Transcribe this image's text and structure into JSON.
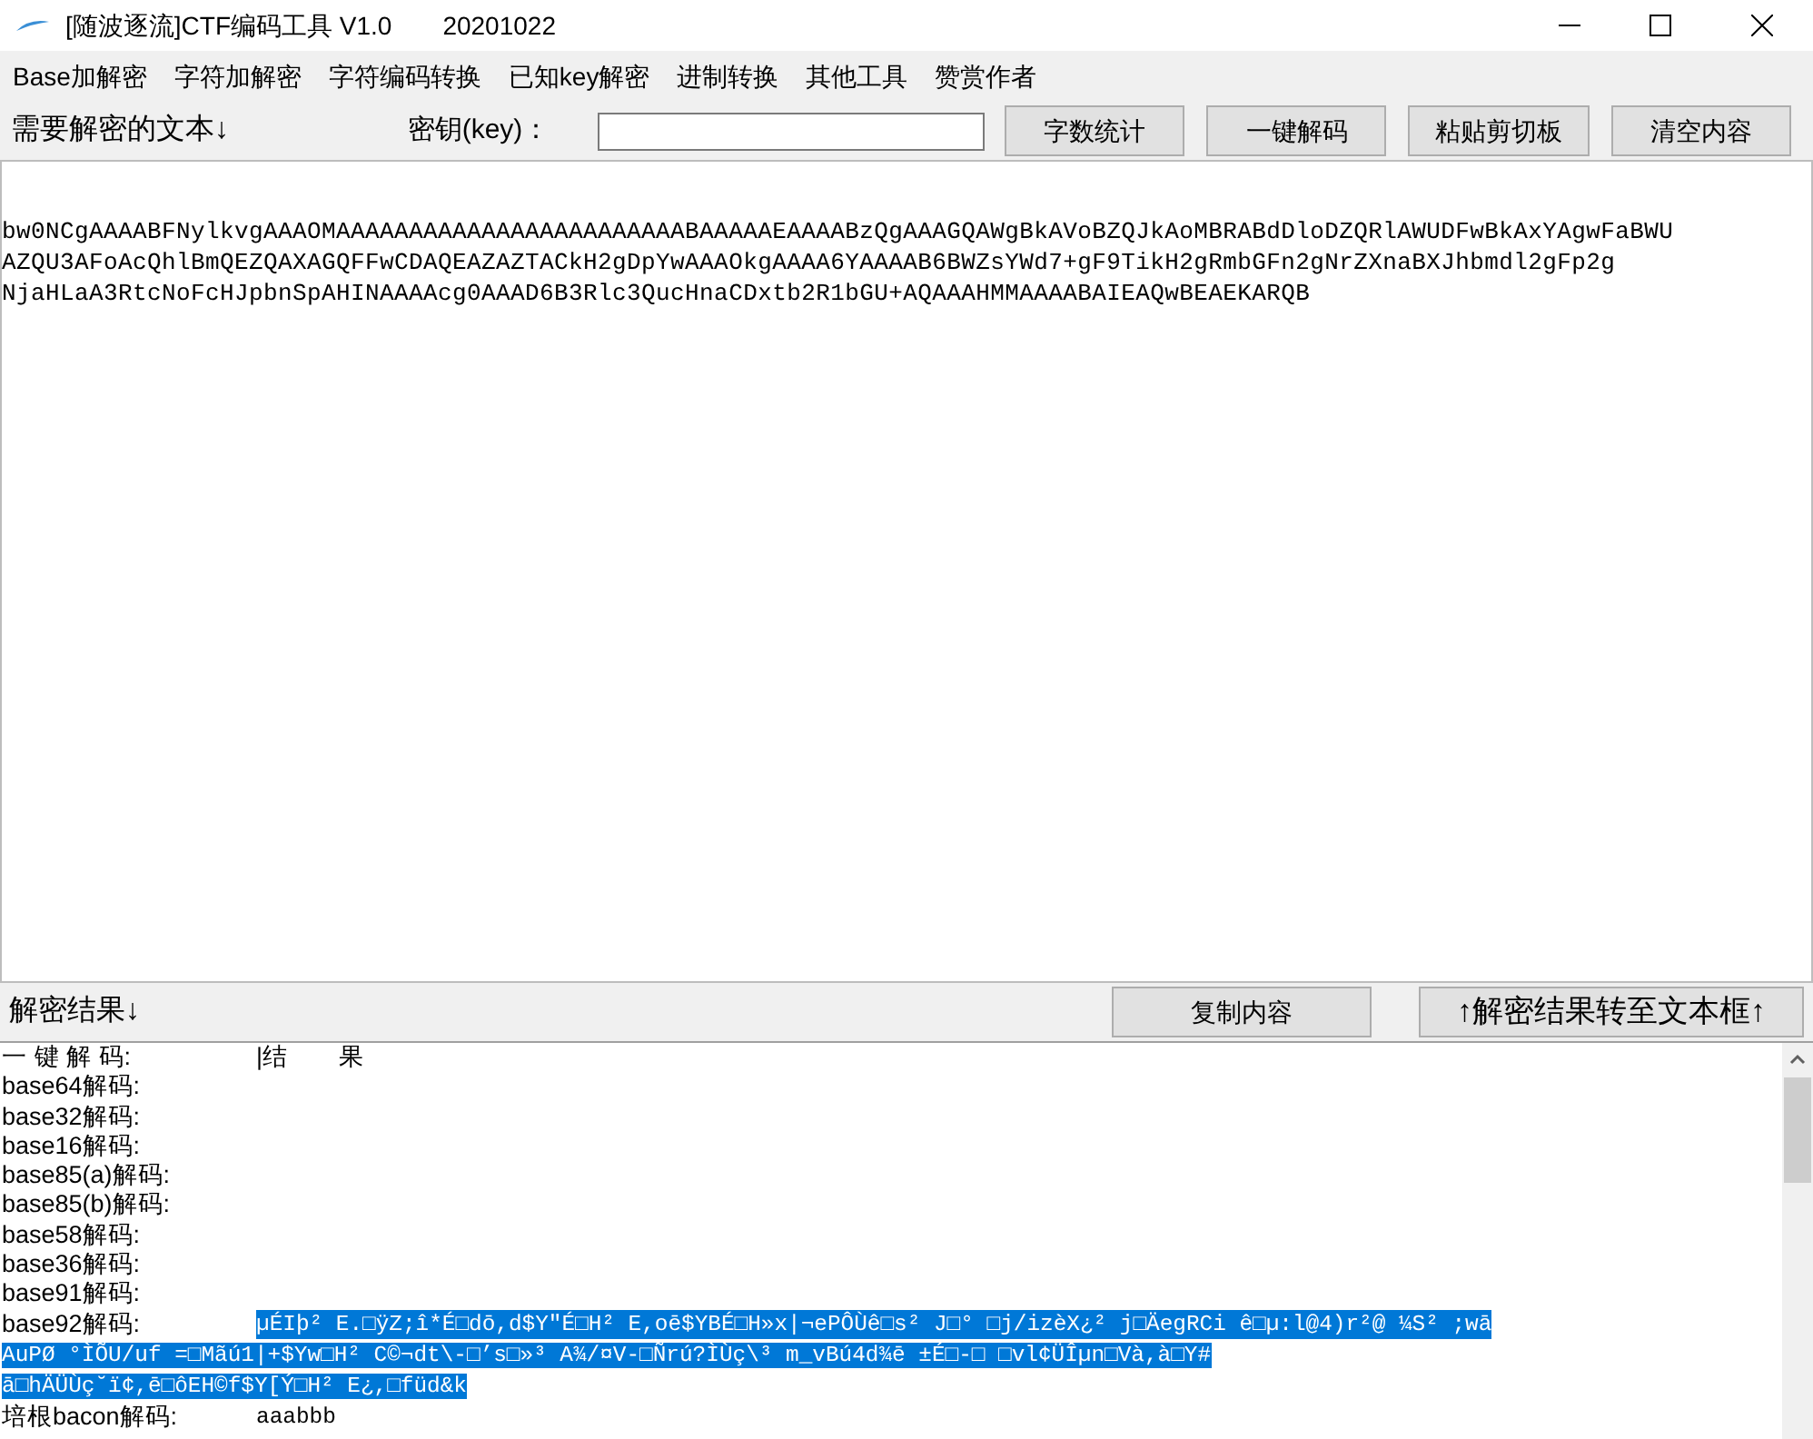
{
  "window": {
    "title": "[随波逐流]CTF编码工具 V1.0",
    "date": "20201022"
  },
  "menu": [
    "Base加解密",
    "字符加解密",
    "字符编码转换",
    "已知key解密",
    "进制转换",
    "其他工具",
    "赞赏作者"
  ],
  "toolbar": {
    "label": "需要解密的文本↓",
    "key_label": "密钥(key)：",
    "buttons": [
      "字数统计",
      "一键解码",
      "粘贴剪切板",
      "清空内容"
    ]
  },
  "input_lines": [
    "bw0NCgAAAABFNylkvgAAAOMAAAAAAAAAAAAAAAAAAAAAAAABAAAAAEAAAABzQgAAAGQAWgBkAVoBZQJkAoMBRABdDloDZQRlAWUDFwBkAxYAgwFaBWU",
    "AZQU3AFoAcQhlBmQEZQAXAGQFFwCDAQEAZAZTACkH2gDpYwAAAOkgAAAA6YAAAAB6BWZsYWd7+gF9TikH2gRmbGFn2gNrZXnaBXJhbmdl2gFp2g",
    "NjaHLaA3RtcNoFcHJpbnSpAHINAAAAcg0AAAD6B3Rlc3QucHnaCDxtb2R1bGU+AQAAAHMMAAAABAIEAQwBEAEKARQB"
  ],
  "result_bar": {
    "label": "解密结果↓",
    "buttons": [
      "复制内容",
      "↑解密结果转至文本框↑"
    ]
  },
  "output": {
    "header": [
      "一 键 解 码:",
      "|结　　果"
    ],
    "rows": [
      {
        "label": "base64解码:",
        "value_lines": [],
        "selected": false
      },
      {
        "label": "base32解码:",
        "value_lines": [],
        "selected": false
      },
      {
        "label": "base16解码:",
        "value_lines": [],
        "selected": false
      },
      {
        "label": "base85(a)解码:",
        "value_lines": [],
        "selected": false
      },
      {
        "label": "base85(b)解码:",
        "value_lines": [],
        "selected": false
      },
      {
        "label": "base58解码:",
        "value_lines": [],
        "selected": false
      },
      {
        "label": "base36解码:",
        "value_lines": [],
        "selected": false
      },
      {
        "label": "base91解码:",
        "value_lines": [],
        "selected": false
      },
      {
        "label": "base92解码:",
        "value_lines": [
          "µÉIþ² E.□ÿZ;î*É□dō,d$Y″É□H² E,oē$YBÉ□H»x|¬ePÔÙê□s² J□° □j/izèX¿² j□ÄegRCi ê□µ:l@4)r²@  ¼S² ;wā",
          "AuPØ  °ÌÕU/uf  =□Mãú1|+$Yw□H² C©¬dt\\-□’s□»³ A¾/¤V-□Ñrú?ÌÙç\\³ m_vBú4d¾ē ±É□-□ □vl¢ÜÎµn□Và,à□Y#",
          "ā□hÄÜÙç˘ï¢,ē□ôEH©f$Y[Ý□H² E¿,□füd&k"
        ],
        "selected": true
      },
      {
        "label": "培根bacon解码:",
        "value_lines": [
          "aaabbb"
        ],
        "selected": false
      }
    ]
  }
}
